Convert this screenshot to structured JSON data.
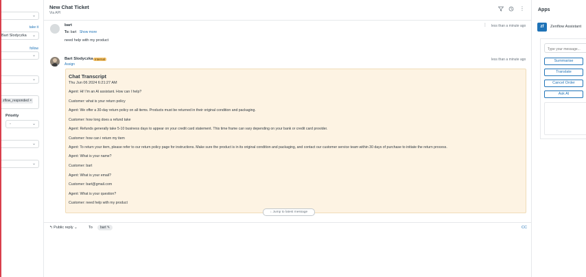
{
  "left_panel": {
    "take_it": "take it",
    "assignee": "Bart Slodyczka",
    "follow": "follow",
    "tag": "zflow_responded",
    "tag_remove": "×",
    "priority_label": "Priority",
    "priority_value": "-"
  },
  "ticket": {
    "title": "New Chat Ticket",
    "subtitle": "Via API"
  },
  "messages": [
    {
      "author": "bart",
      "to_label": "To:",
      "to_value": "bart",
      "show_more": "Show more",
      "body": "need help with my product",
      "time": "less than a minute ago"
    },
    {
      "author": "Bart Slodyczka",
      "badge": "Internal",
      "assign": "Assign",
      "time": "less than a minute ago"
    }
  ],
  "transcript": {
    "title": "Chat Transcript",
    "date": "Thu Jun 06 2024 6:21:27 AM",
    "lines": [
      "Agent: Hi! I'm an AI assistant. How can I help?",
      "Customer: what is your return policy",
      "Agent: We offer a 30-day return policy on all items. Products must be returned in their original condition and packaging.",
      "Customer: how long does a refund take",
      "Agent: Refunds generally take 5-10 business days to appear on your credit card statement. This time frame can vary depending on your bank or credit card provider.",
      "Customer: how can i return my item",
      "Agent: To return your item, please refer to our return policy page for instructions. Make sure the product is in its original condition and packaging, and contact our customer service team within 30 days of purchase to initiate the return process.",
      "Agent: What is your name?",
      "Customer: bart",
      "Agent: What is your email?",
      "Customer: bart@gmail.com",
      "Agent: What is your question?",
      "Customer: need help with my product"
    ],
    "jump_label": "Jump to latest message"
  },
  "reply": {
    "type": "Public reply",
    "to_label": "To",
    "recipient": "bart",
    "cc": "CC"
  },
  "apps": {
    "title": "Apps",
    "app_logo": "zf",
    "app_name": "Zenflow Assistant",
    "input_placeholder": "Type your message...",
    "buttons": [
      "Summarise",
      "Translate",
      "Cancel Order",
      "Ask AI"
    ]
  },
  "icons": {
    "filter": "filter-icon",
    "history": "history-icon",
    "more": "more-vertical-icon",
    "chevron": "chevron-down-icon",
    "pencil": "pencil-icon",
    "arrow_down": "arrow-down-icon"
  },
  "colors": {
    "brand": "#1f73b7",
    "internal_note_bg": "#fdf3e3",
    "internal_badge": "#f6c36a",
    "left_accent": "#d93f4c"
  }
}
